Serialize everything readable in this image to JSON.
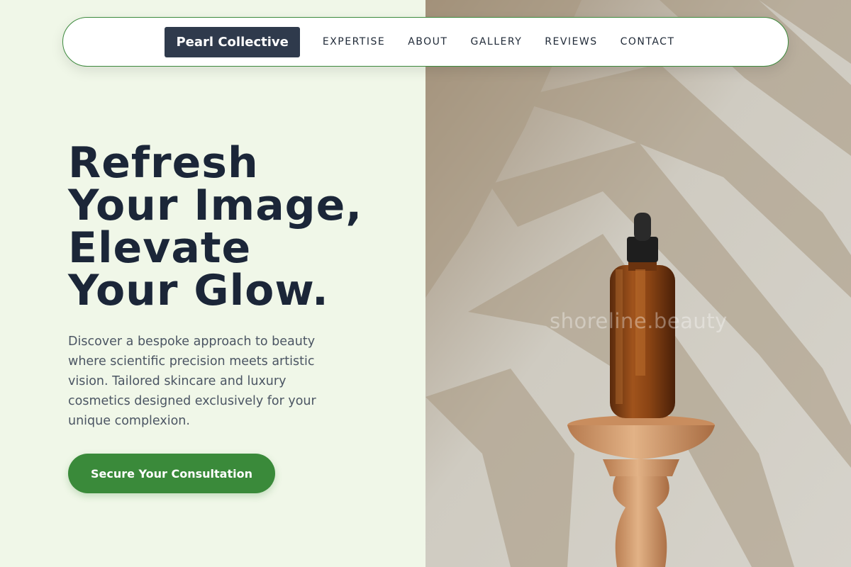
{
  "navbar": {
    "brand": "Pearl Collective",
    "links": [
      "EXPERTISE",
      "ABOUT",
      "GALLERY",
      "REVIEWS",
      "CONTACT"
    ]
  },
  "hero": {
    "title_lines": [
      "Refresh",
      "Your Image,",
      "Elevate",
      "Your Glow."
    ],
    "description": "Discover a bespoke approach to beauty where scientific precision meets artistic vision. Tailored skincare and luxury cosmetics designed exclusively for your unique complexion.",
    "cta_label": "Secure Your Consultation"
  },
  "image": {
    "watermark": "shoreline.beauty",
    "subject": "amber dropper bottle on wooden pedestal with palm leaf shadows"
  },
  "colors": {
    "left_background": "#f0f7e8",
    "brand_background": "#2f3a4c",
    "title_text": "#1b2638",
    "cta_background": "#3a8a3a",
    "navbar_border": "#3d8a3d"
  }
}
